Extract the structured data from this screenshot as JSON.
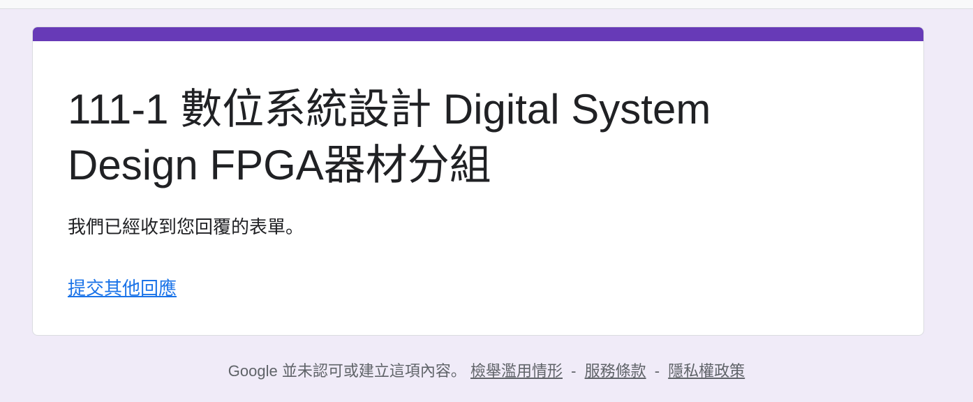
{
  "form": {
    "title": "111-1 數位系統設計 Digital System Design FPGA器材分組",
    "confirmation_message": "我們已經收到您回覆的表單。",
    "submit_another_link": "提交其他回應"
  },
  "footer": {
    "disclaimer": "Google 並未認可或建立這項內容。",
    "report_abuse": "檢舉濫用情形",
    "separator": "-",
    "terms": "服務條款",
    "privacy": "隱私權政策"
  },
  "colors": {
    "background": "#f0ebf8",
    "accent": "#673ab7",
    "link": "#1a73e8",
    "text": "#202124",
    "footer_text": "#5f6368"
  }
}
